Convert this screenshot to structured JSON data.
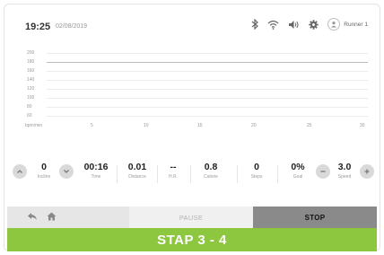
{
  "status_bar": {
    "time": "19:25",
    "date": "02/08/2019",
    "user_name": "Runner 1",
    "icons": [
      "bluetooth-icon",
      "wifi-icon",
      "volume-icon",
      "settings-gear-icon",
      "user-avatar-icon"
    ]
  },
  "chart_data": {
    "type": "line",
    "ylabel": "bpm/min",
    "y_ticks": [
      "200",
      "180",
      "160",
      "140",
      "120",
      "100",
      "80",
      "60"
    ],
    "x_ticks": [
      "5",
      "10",
      "15",
      "20",
      "25",
      "30"
    ],
    "xlim": [
      0,
      30
    ],
    "ylim": [
      60,
      200
    ],
    "grid": true,
    "series": []
  },
  "stats": {
    "incline": {
      "value": "0",
      "label": "Incline"
    },
    "time": {
      "value": "00:16",
      "label": "Time"
    },
    "distance": {
      "value": "0.01",
      "label": "Distance"
    },
    "hr": {
      "value": "--",
      "label": "H.R."
    },
    "calorie": {
      "value": "0.8",
      "label": "Calorie"
    },
    "steps": {
      "value": "0",
      "label": "Steps"
    },
    "goal": {
      "value": "0%",
      "label": "Goal"
    },
    "speed": {
      "value": "3.0",
      "label": "Speed"
    }
  },
  "buttons": {
    "pause": "PAUSE",
    "stop": "STOP"
  },
  "banner": {
    "text": "STAP 3 - 4",
    "color": "#8dc63f"
  }
}
